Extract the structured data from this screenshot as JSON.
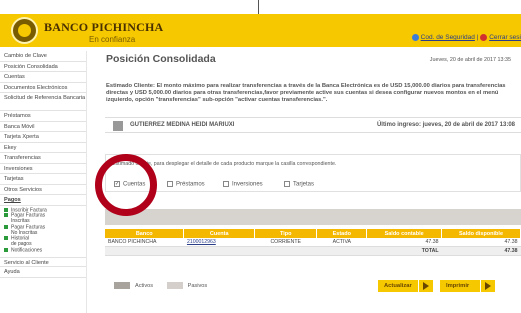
{
  "header": {
    "brand": "BANCO PICHINCHA",
    "tagline": "En confianza",
    "security_link": "Cod. de Seguridad",
    "separator": "|",
    "logout_link": "Cerrar sesi",
    "security_icon_color": "#3a7bd5",
    "logout_icon_color": "#d03030"
  },
  "sidebar": {
    "items": [
      "Cambio de Clave",
      "Posición Consolidada",
      "Cuentas",
      "Documentos Electrónicos",
      "Solicitud de Referencia Bancaria",
      "Préstamos",
      "Banca Móvil",
      "Tarjeta Xperta",
      "Ekey",
      "Transferencias",
      "Inversiones",
      "Tarjetas",
      "Otros Servicios",
      "Pagos"
    ],
    "pagos_sub": [
      {
        "line1": "Inscribir Factura",
        "line2": ""
      },
      {
        "line1": "Pagar Facturas",
        "line2": "Inscritas"
      },
      {
        "line1": "Pagar Facturas",
        "line2": "No Inscritas"
      },
      {
        "line1": "Historial",
        "line2": "de pagos"
      },
      {
        "line1": "Notificaciones",
        "line2": ""
      }
    ],
    "bottom_items": [
      "Servicio al Cliente",
      "Ayuda"
    ]
  },
  "main": {
    "title": "Posición Consolidada",
    "date": "Jueves, 20 de abril de 2017 13:35",
    "notice": "Estimado Cliente: El monto máximo para realizar transferencias a través de la Banca Electrónica es de USD 15,000.00 diarios para transferencias directas y USD 5,000.00 diarios para otras transferencias,favor previamente active sus cuentas si desea configurar nuevos montos en el menú izquierdo, opción \"transferencias\" sub-opción \"activar cuentas transferencias.\".",
    "user_name": "GUTIERREZ MEDINA HEIDI MARIUXI",
    "last_login": "Último ingreso: jueves, 20 de abril de 2017 13:08",
    "instruction": "Estimado cliente, para desplegar el detalle de cada producto marque la casilla correspondiente.",
    "checkboxes": [
      {
        "label": "Cuentas",
        "checked": true
      },
      {
        "label": "Préstamos",
        "checked": false
      },
      {
        "label": "Inversiones",
        "checked": false
      },
      {
        "label": "Tarjetas",
        "checked": false
      }
    ],
    "table": {
      "headers": [
        "Banco",
        "Cuenta",
        "Tipo",
        "Estado",
        "Saldo contable",
        "Saldo disponible"
      ],
      "row": {
        "banco": "BANCO PICHINCHA",
        "cuenta": "2100012963",
        "tipo": "CORRIENTE",
        "estado": "ACTIVA",
        "saldo_contable": "47.38",
        "saldo_disponible": "47.38"
      },
      "total_label": "TOTAL",
      "total_value": "47.38"
    },
    "legend": {
      "activos": "Activos",
      "pasivos": "Pasivos"
    },
    "buttons": {
      "actualizar": "Actualizar",
      "imprimir": "Imprimir"
    }
  },
  "colors": {
    "brand_yellow": "#f5c800",
    "header_table": "#f5b800",
    "highlight_circle": "#b0001a",
    "activos_swatch": "#a8a39d",
    "pasivos_swatch": "#d4cfca"
  }
}
